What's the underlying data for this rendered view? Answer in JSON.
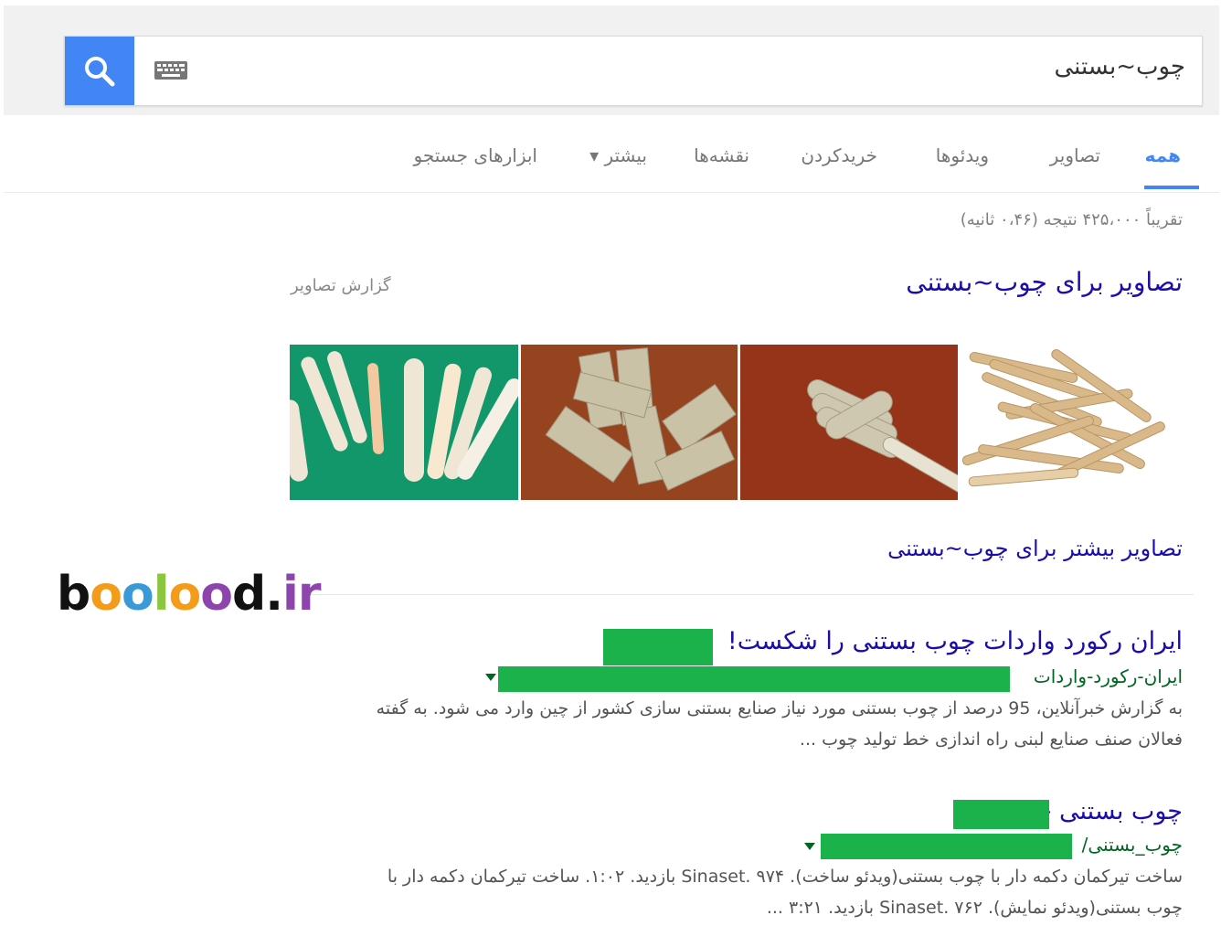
{
  "search": {
    "query": "چوب~بستنی",
    "search_icon": "search-icon",
    "keyboard_icon": "keyboard-icon",
    "accent": "#4285f4"
  },
  "tabs": [
    {
      "label": "همه",
      "active": true
    },
    {
      "label": "تصاویر"
    },
    {
      "label": "ویدئوها"
    },
    {
      "label": "خریدکردن"
    },
    {
      "label": "نقشه‌ها"
    },
    {
      "label": "بیشتر ▾"
    },
    {
      "label": "ابزارهای جستجو"
    }
  ],
  "stats": "تقریباً ۴۲۵،۰۰۰ نتیجه (۰،۴۶ ثانیه)",
  "images": {
    "title": "تصاویر برای چوب~بستنی",
    "report": "گزارش تصاویر",
    "more": "تصاویر بیشتر برای چوب~بستنی"
  },
  "logo": {
    "text": "boolood.ir"
  },
  "results": [
    {
      "title": "ایران رکورد واردات چوب بستنی را شکست!",
      "url": "ایران-رکورد-واردات",
      "snippet_line1": "به گزارش خبرآنلاین، 95 درصد از چوب بستنی مورد نیاز صنایع بستنی سازی کشور از چین وارد می شود. به گفته",
      "snippet_line2": "فعالان صنف صنایع لبنی راه اندازی خط تولید چوب ..."
    },
    {
      "title": "چوب بستنی -",
      "url": "چوب_بستنی/",
      "snippet_line1": "ساخت تیرکمان دکمه دار با چوب بستنی(ویدئو ساخت). ۹۷۴ .Sinaset بازدید. ۱:۰۲. ساخت تیرکمان دکمه دار با",
      "snippet_line2": "چوب بستنی(ویدئو نمایش). ۷۶۲ .Sinaset بازدید. ۳:۲۱ ..."
    }
  ]
}
